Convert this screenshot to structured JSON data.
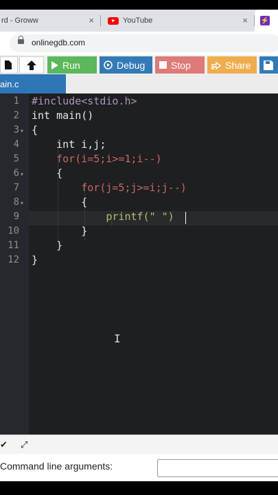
{
  "browser": {
    "tabs": [
      {
        "label": "rd - Groww"
      },
      {
        "label": "YouTube"
      },
      {
        "label": ""
      }
    ],
    "close_glyph": "×",
    "url": "onlinegdb.com"
  },
  "toolbar": {
    "run_label": "Run",
    "debug_label": "Debug",
    "stop_label": "Stop",
    "share_label": "Share"
  },
  "file_tab": {
    "label": "ain.c"
  },
  "editor": {
    "line_numbers": [
      "1",
      "2",
      "3",
      "4",
      "5",
      "6",
      "7",
      "8",
      "9",
      "10",
      "11",
      "12"
    ],
    "lines": [
      "#include<stdio.h>",
      "int main()",
      "{",
      "    int i,j;",
      "    for(i=5;i>=1;i--)",
      "    {",
      "        for(j=5;j>=i;j--)",
      "        {",
      "            printf(\" \")",
      "        }",
      "    }",
      "}"
    ],
    "colors": {
      "background": "#1d1f21",
      "gutter": "#25282c",
      "keyword": "#cc6666",
      "string": "#b5bd68",
      "number": "#de935f",
      "preprocessor": "#b294bb"
    }
  },
  "bottom": {
    "args_label": "Command line arguments:"
  },
  "accent_colors": {
    "run": "#5cb85c",
    "debug": "#337ab7",
    "stop": "#d9534f",
    "share": "#f0ad4e",
    "file_tab": "#2e76b6"
  }
}
